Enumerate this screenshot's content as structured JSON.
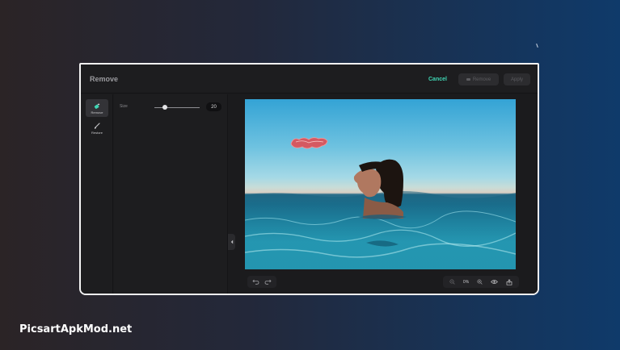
{
  "editor": {
    "title": "Remove",
    "cancel_label": "Cancel",
    "remove_label": "Remove",
    "apply_label": "Apply"
  },
  "tools": [
    {
      "label": "Remove",
      "icon": "eraser-sparkle-icon",
      "active": true
    },
    {
      "label": "Restore",
      "icon": "brush-icon",
      "active": false
    }
  ],
  "settings": {
    "size_label": "Size",
    "size_value": "20",
    "size_fraction": 0.25
  },
  "canvas": {
    "zoom_label": "0%",
    "icons": [
      "undo-icon",
      "redo-icon",
      "zoom-out-icon",
      "zoom-in-icon",
      "preview-eye-icon",
      "compare-icon"
    ]
  },
  "colors": {
    "accent": "#3fd6b4",
    "selection": "#e8474b",
    "frame": "#f4f4f4"
  },
  "watermark": "PicsartApkMod.net"
}
